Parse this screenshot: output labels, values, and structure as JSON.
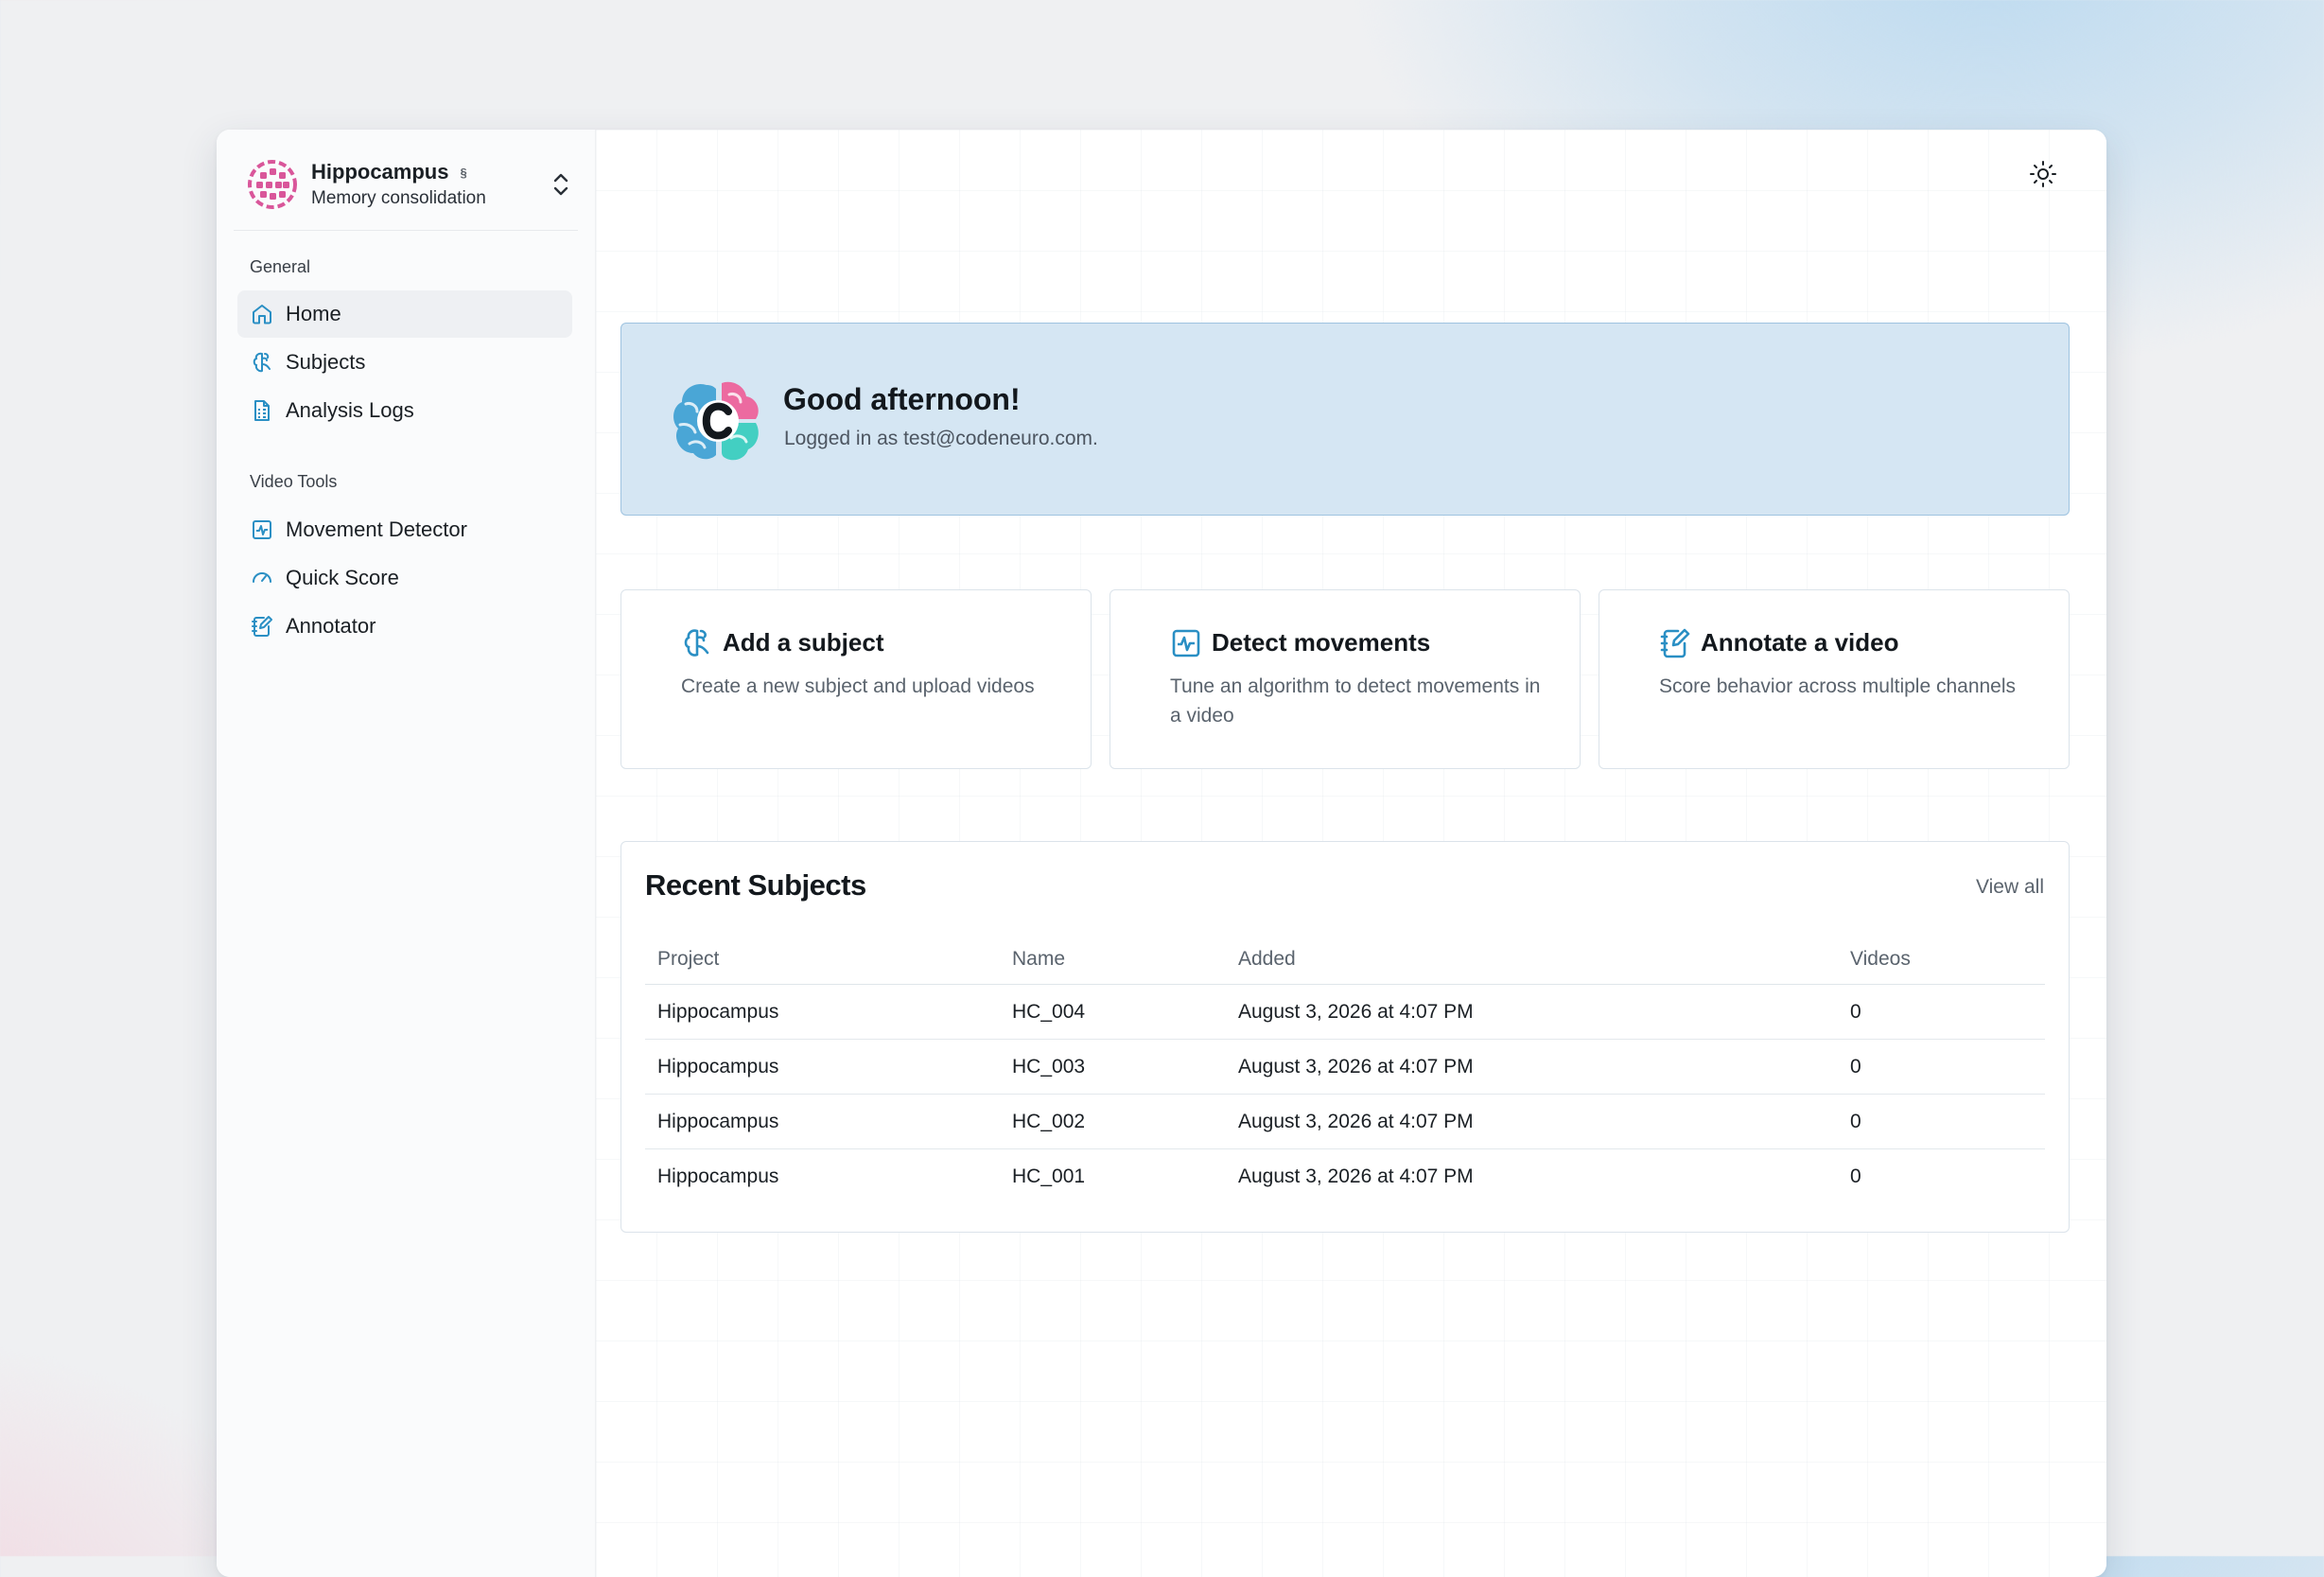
{
  "sidebar": {
    "project": {
      "name": "Hippocampus",
      "badge": "§",
      "subtitle": "Memory consolidation"
    },
    "sections": [
      {
        "label": "General",
        "items": [
          {
            "label": "Home",
            "icon": "home-icon",
            "active": true
          },
          {
            "label": "Subjects",
            "icon": "brain-icon"
          },
          {
            "label": "Analysis Logs",
            "icon": "document-icon"
          }
        ]
      },
      {
        "label": "Video Tools",
        "items": [
          {
            "label": "Movement Detector",
            "icon": "activity-icon"
          },
          {
            "label": "Quick Score",
            "icon": "gauge-icon"
          },
          {
            "label": "Annotator",
            "icon": "notebook-pen-icon"
          }
        ]
      }
    ]
  },
  "header": {
    "theme_toggle_icon": "sun-icon"
  },
  "welcome": {
    "title": "Good afternoon!",
    "subtitle": "Logged in as test@codeneuro.com."
  },
  "quick_actions": [
    {
      "title": "Add a subject",
      "description": "Create a new subject and upload videos",
      "icon": "brain-icon"
    },
    {
      "title": "Detect movements",
      "description": "Tune an algorithm to detect movements in a video",
      "icon": "activity-icon"
    },
    {
      "title": "Annotate a video",
      "description": "Score behavior across multiple channels",
      "icon": "notebook-pen-icon"
    }
  ],
  "recent_subjects": {
    "title": "Recent Subjects",
    "view_all": "View all",
    "columns": [
      "Project",
      "Name",
      "Added",
      "Videos"
    ],
    "rows": [
      [
        "Hippocampus",
        "HC_004",
        "August 3, 2026 at 4:07 PM",
        "0"
      ],
      [
        "Hippocampus",
        "HC_003",
        "August 3, 2026 at 4:07 PM",
        "0"
      ],
      [
        "Hippocampus",
        "HC_002",
        "August 3, 2026 at 4:07 PM",
        "0"
      ],
      [
        "Hippocampus",
        "HC_001",
        "August 3, 2026 at 4:07 PM",
        "0"
      ]
    ]
  },
  "colors": {
    "accent": "#2a8fc4",
    "banner_bg": "#d5e6f3",
    "banner_border": "#9ec3e0",
    "brand_pink": "#d9569a"
  }
}
